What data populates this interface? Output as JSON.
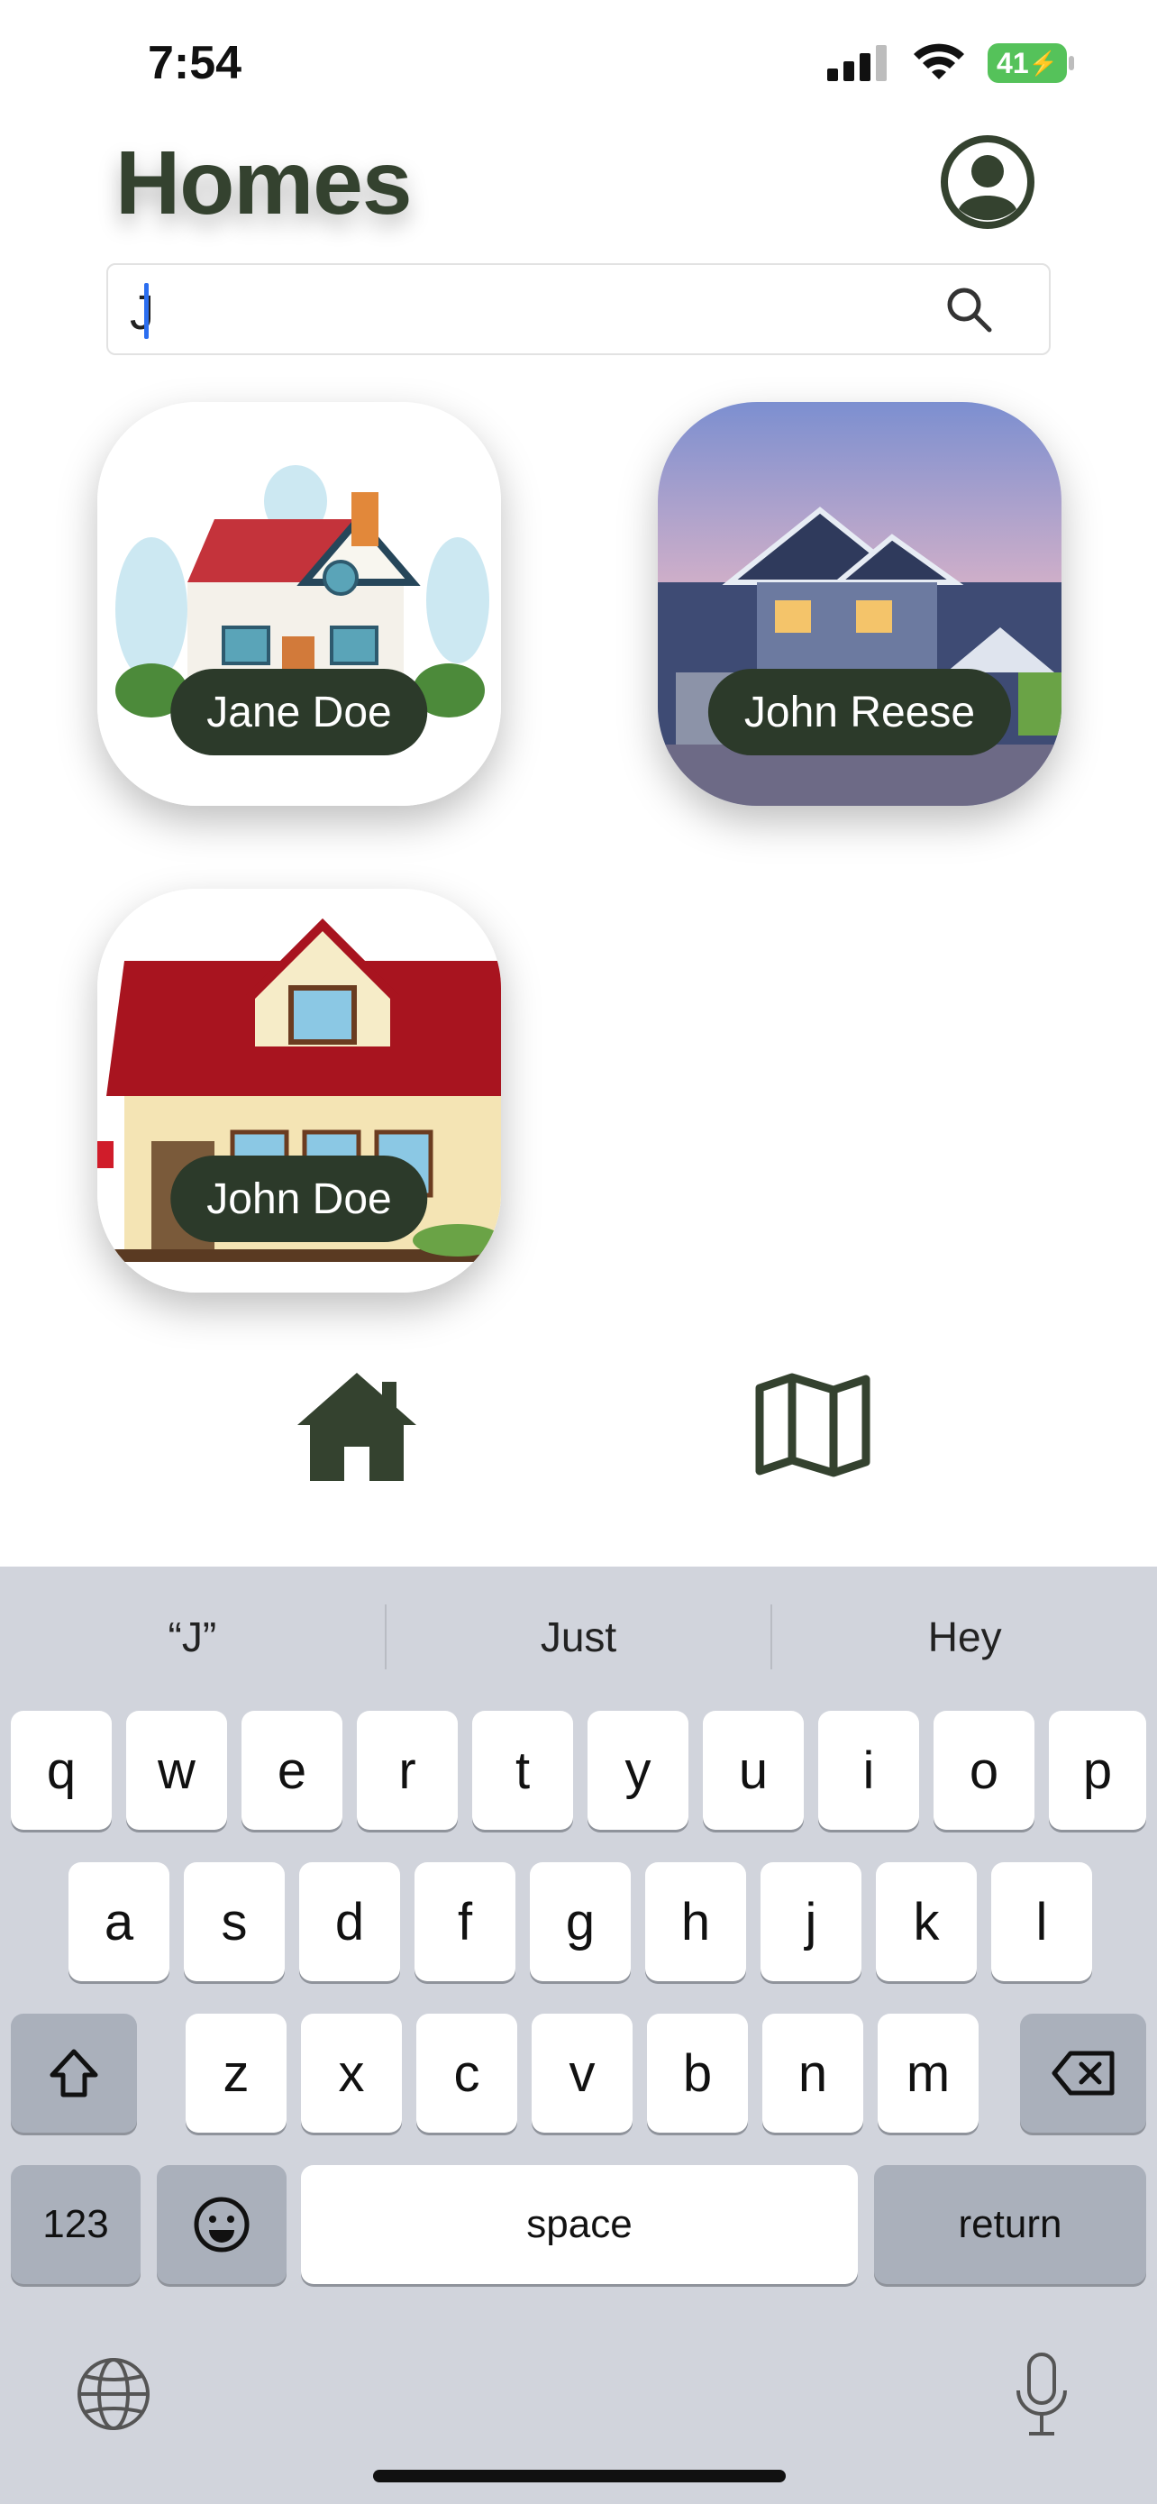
{
  "status_bar": {
    "time": "7:54",
    "battery": "41"
  },
  "header": {
    "title": "Homes"
  },
  "search": {
    "value": "J",
    "placeholder": ""
  },
  "homes": [
    {
      "name": "Jane Doe"
    },
    {
      "name": "John Reese"
    },
    {
      "name": "John Doe"
    }
  ],
  "tabs": [
    {
      "icon": "house-icon",
      "active": true
    },
    {
      "icon": "map-icon",
      "active": false
    }
  ],
  "keyboard": {
    "suggestions": [
      "“J”",
      "Just",
      "Hey"
    ],
    "row1": [
      "q",
      "w",
      "e",
      "r",
      "t",
      "y",
      "u",
      "i",
      "o",
      "p"
    ],
    "row2": [
      "a",
      "s",
      "d",
      "f",
      "g",
      "h",
      "j",
      "k",
      "l"
    ],
    "row3": [
      "z",
      "x",
      "c",
      "v",
      "b",
      "n",
      "m"
    ],
    "numbers_key": "123",
    "space_key": "space",
    "return_key": "return"
  },
  "colors": {
    "accent": "#34422f",
    "pill": "#2c3a2a",
    "caret": "#2b6ef0",
    "keyboard_bg": "#d1d4dc"
  }
}
